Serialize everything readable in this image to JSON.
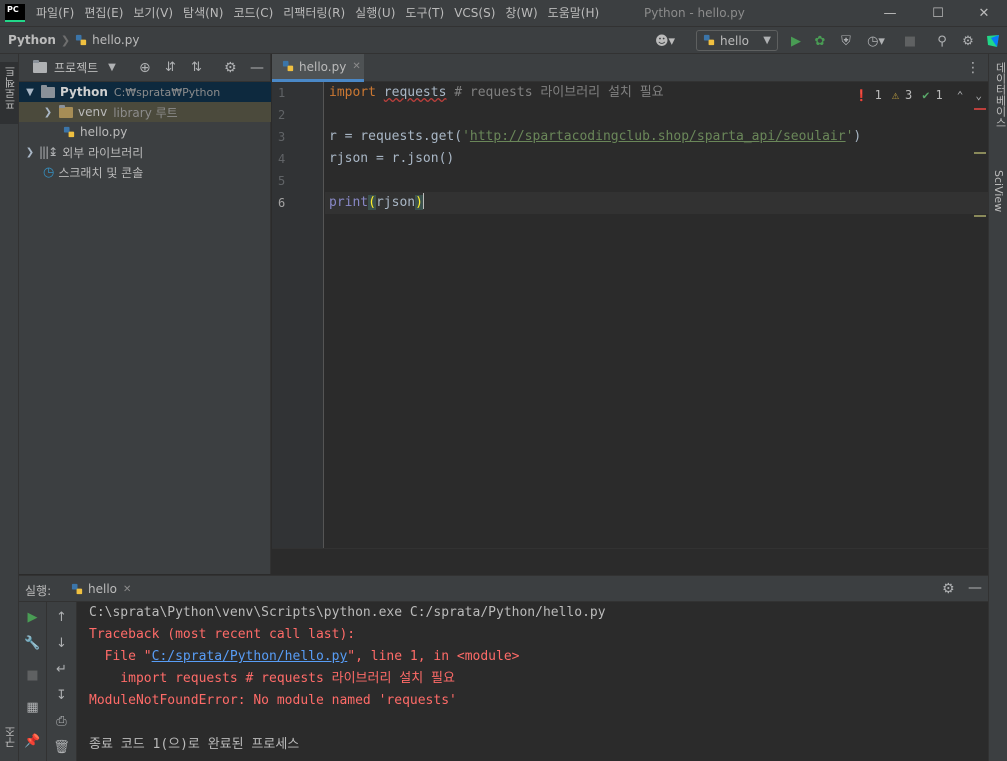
{
  "window": {
    "title": "Python - hello.py",
    "logo_text": "PC"
  },
  "menu": [
    "파일(F)",
    "편집(E)",
    "보기(V)",
    "탐색(N)",
    "코드(C)",
    "리팩터링(R)",
    "실행(U)",
    "도구(T)",
    "VCS(S)",
    "창(W)",
    "도움말(H)"
  ],
  "breadcrumb": {
    "project": "Python",
    "file": "hello.py"
  },
  "run_config": {
    "name": "hello"
  },
  "project_panel": {
    "title": "프로젝트",
    "tree": {
      "root_name": "Python",
      "root_path": "C:₩sprata₩Python",
      "venv_name": "venv",
      "venv_hint": "library 루트",
      "file_name": "hello.py",
      "external_libs": "외부 라이브러리",
      "scratches": "스크래치 및 콘솔"
    }
  },
  "left_strip": {
    "project_label": "프로젝트",
    "structure_label": "구조"
  },
  "right_strip": {
    "database_label": "데이터베이스",
    "sciview_label": "SciView"
  },
  "editor": {
    "tab_label": "hello.py",
    "line_numbers": [
      "1",
      "2",
      "3",
      "4",
      "5",
      "6"
    ],
    "lines": {
      "l1_kw": "import",
      "l1_mod": "requests",
      "l1_comment": " # requests 라이브러리 설치 필요",
      "l3_pre": "r = requests.get(",
      "l3_q1": "'",
      "l3_url": "http://spartacodingclub.shop/sparta_api/seoulair",
      "l3_q2": "'",
      "l3_post": ")",
      "l4": "rjson = r.json()",
      "l6_fn": "print",
      "l6_open": "(",
      "l6_arg": "rjson",
      "l6_close": ")"
    },
    "inspection": {
      "errors": "1",
      "warnings": "3",
      "weak": "1"
    }
  },
  "run_panel": {
    "label": "실행:",
    "tab": "hello",
    "console": {
      "cmd": "C:\\sprata\\Python\\venv\\Scripts\\python.exe C:/sprata/Python/hello.py",
      "tb1": "Traceback (most recent call last):",
      "tb2_pre": "  File \"",
      "tb2_link": "C:/sprata/Python/hello.py",
      "tb2_post": "\", line 1, in <module>",
      "tb3": "    import requests # requests 라이브러리 설치 필요",
      "tb4": "ModuleNotFoundError: No module named 'requests'",
      "exit": "종료 코드 1(으)로 완료된 프로세스"
    }
  },
  "colors": {
    "background": "#2b2b2b",
    "panel": "#3c3f41",
    "keyword": "#cc7832",
    "string": "#6a8759",
    "error_text": "#ff6b68",
    "link": "#589df6",
    "accent": "#4a88c7"
  }
}
